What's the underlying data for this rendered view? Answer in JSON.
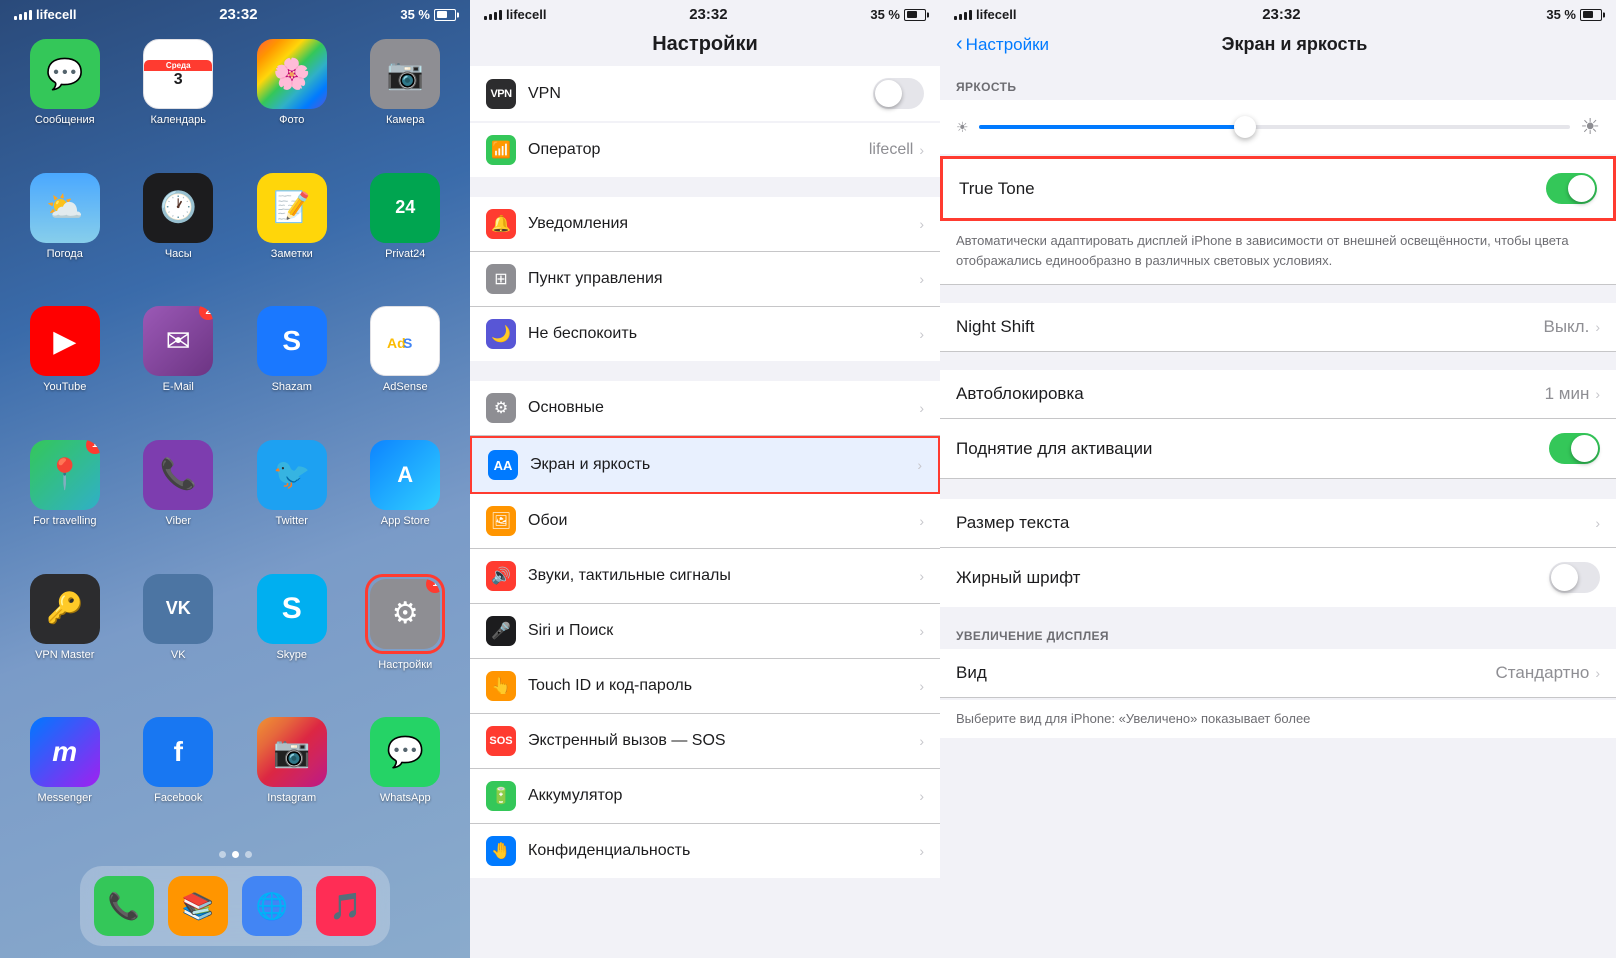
{
  "panel1": {
    "status": {
      "carrier": "lifecell",
      "time": "23:32",
      "battery": "35 %"
    },
    "apps": [
      {
        "id": "messages",
        "label": "Сообщения",
        "badge": null,
        "icon": "💬",
        "bg": "icon-messages"
      },
      {
        "id": "calendar",
        "label": "Календарь",
        "badge": null,
        "icon": "cal",
        "bg": "icon-calendar"
      },
      {
        "id": "photos",
        "label": "Фото",
        "badge": null,
        "icon": "🖼",
        "bg": "icon-photos"
      },
      {
        "id": "camera",
        "label": "Камера",
        "badge": null,
        "icon": "📷",
        "bg": "icon-camera"
      },
      {
        "id": "weather",
        "label": "Погода",
        "badge": null,
        "icon": "🌤",
        "bg": "icon-weather"
      },
      {
        "id": "clock",
        "label": "Часы",
        "badge": null,
        "icon": "⏰",
        "bg": "icon-clock"
      },
      {
        "id": "notes",
        "label": "Заметки",
        "badge": null,
        "icon": "📝",
        "bg": "icon-notes"
      },
      {
        "id": "privat24",
        "label": "Privat24",
        "badge": null,
        "icon": "24",
        "bg": "icon-privat"
      },
      {
        "id": "youtube",
        "label": "YouTube",
        "badge": null,
        "icon": "▶",
        "bg": "icon-youtube"
      },
      {
        "id": "email",
        "label": "E-Mail",
        "badge": "2",
        "icon": "✉",
        "bg": "icon-email"
      },
      {
        "id": "shazam",
        "label": "Shazam",
        "badge": null,
        "icon": "S",
        "bg": "icon-shazam"
      },
      {
        "id": "adsense",
        "label": "AdSense",
        "badge": null,
        "icon": "$",
        "bg": "icon-adsense"
      },
      {
        "id": "maps",
        "label": "For travelling",
        "badge": "1",
        "icon": "📍",
        "bg": "icon-maps"
      },
      {
        "id": "viber",
        "label": "Viber",
        "badge": null,
        "icon": "📞",
        "bg": "icon-viber"
      },
      {
        "id": "twitter",
        "label": "Twitter",
        "badge": null,
        "icon": "🐦",
        "bg": "icon-twitter"
      },
      {
        "id": "appstore",
        "label": "App Store",
        "badge": null,
        "icon": "A",
        "bg": "icon-appstore"
      },
      {
        "id": "vpn",
        "label": "VPN Master",
        "badge": null,
        "icon": "🔑",
        "bg": "icon-vpn"
      },
      {
        "id": "vk",
        "label": "VK",
        "badge": null,
        "icon": "VK",
        "bg": "icon-vk"
      },
      {
        "id": "skype",
        "label": "Skype",
        "badge": null,
        "icon": "S",
        "bg": "icon-skype"
      },
      {
        "id": "settings",
        "label": "Настройки",
        "badge": "1",
        "icon": "⚙",
        "bg": "icon-settings",
        "highlight": true
      },
      {
        "id": "messenger",
        "label": "Messenger",
        "badge": null,
        "icon": "m",
        "bg": "icon-messenger"
      },
      {
        "id": "facebook",
        "label": "Facebook",
        "badge": null,
        "icon": "f",
        "bg": "icon-facebook"
      },
      {
        "id": "instagram",
        "label": "Instagram",
        "badge": null,
        "icon": "📷",
        "bg": "icon-instagram"
      },
      {
        "id": "whatsapp",
        "label": "WhatsApp",
        "badge": null,
        "icon": "💬",
        "bg": "icon-whatsapp"
      }
    ],
    "dock": [
      {
        "id": "phone",
        "icon": "📞",
        "bg": "bg-green"
      },
      {
        "id": "ibooks",
        "icon": "📚",
        "bg": "bg-orange"
      },
      {
        "id": "chrome",
        "icon": "🌐",
        "bg": "bg-blue"
      },
      {
        "id": "music",
        "icon": "🎵",
        "bg": "bg-pink"
      }
    ]
  },
  "panel2": {
    "status": {
      "carrier": "lifecell",
      "time": "23:32",
      "battery": "35 %"
    },
    "title": "Настройки",
    "items": [
      {
        "id": "vpn",
        "label": "VPN",
        "value": "",
        "icon": "vpn",
        "iconColor": "#2c2c2e",
        "iconText": "VPN",
        "hasToggle": true,
        "toggleOn": false
      },
      {
        "id": "operator",
        "label": "Оператор",
        "value": "lifecell",
        "icon": "phone",
        "iconColor": "#34c759",
        "iconText": "📶",
        "hasChevron": true
      },
      {
        "id": "separator1",
        "type": "separator"
      },
      {
        "id": "notifications",
        "label": "Уведомления",
        "value": "",
        "icon": "notif",
        "iconColor": "#ff3b30",
        "iconText": "🔔",
        "hasChevron": true
      },
      {
        "id": "control",
        "label": "Пункт управления",
        "value": "",
        "icon": "ctrl",
        "iconColor": "#8e8e93",
        "iconText": "⊞",
        "hasChevron": true
      },
      {
        "id": "donotdisturb",
        "label": "Не беспокоить",
        "value": "",
        "icon": "dnd",
        "iconColor": "#5856d6",
        "iconText": "🌙",
        "hasChevron": true
      },
      {
        "id": "separator2",
        "type": "separator"
      },
      {
        "id": "general",
        "label": "Основные",
        "value": "",
        "icon": "gen",
        "iconColor": "#8e8e93",
        "iconText": "⚙",
        "hasChevron": true
      },
      {
        "id": "screenbrightness",
        "label": "Экран и яркость",
        "value": "",
        "icon": "screen",
        "iconColor": "#007aff",
        "iconText": "AA",
        "hasChevron": true,
        "highlighted": true
      },
      {
        "id": "wallpaper",
        "label": "Обои",
        "value": "",
        "icon": "wall",
        "iconColor": "#ff9500",
        "iconText": "🖼",
        "hasChevron": true
      },
      {
        "id": "sounds",
        "label": "Звуки, тактильные сигналы",
        "value": "",
        "icon": "sound",
        "iconColor": "#ff3b30",
        "iconText": "🔊",
        "hasChevron": true
      },
      {
        "id": "siri",
        "label": "Siri и Поиск",
        "value": "",
        "icon": "siri",
        "iconColor": "#000",
        "iconText": "🎤",
        "hasChevron": true
      },
      {
        "id": "touchid",
        "label": "Touch ID и код-пароль",
        "value": "",
        "icon": "touch",
        "iconColor": "#ff9500",
        "iconText": "👆",
        "hasChevron": true
      },
      {
        "id": "sos",
        "label": "Экстренный вызов — SOS",
        "value": "",
        "icon": "sos",
        "iconColor": "#ff3b30",
        "iconText": "SOS",
        "hasChevron": true
      },
      {
        "id": "battery",
        "label": "Аккумулятор",
        "value": "",
        "icon": "batt",
        "iconColor": "#34c759",
        "iconText": "🔋",
        "hasChevron": true
      },
      {
        "id": "privacy",
        "label": "Конфиденциальность",
        "value": "",
        "icon": "priv",
        "iconColor": "#007aff",
        "iconText": "🤚",
        "hasChevron": true
      }
    ]
  },
  "panel3": {
    "status": {
      "carrier": "lifecell",
      "time": "23:32",
      "battery": "35 %"
    },
    "backLabel": "Настройки",
    "title": "Экран и яркость",
    "brightnessSection": "ЯРКОСТЬ",
    "trueToneLabel": "True Tone",
    "trueToneOn": true,
    "trueToneDesc": "Автоматически адаптировать дисплей iPhone в зависимости от внешней освещённости, чтобы цвета отображались единообразно в различных световых условиях.",
    "nightShiftLabel": "Night Shift",
    "nightShiftValue": "Выкл.",
    "autolockLabel": "Автоблокировка",
    "autolockValue": "1 мин",
    "raiseLabel": "Поднятие для активации",
    "raiseOn": true,
    "textSizeLabel": "Размер текста",
    "boldLabel": "Жирный шрифт",
    "boldOn": false,
    "zoomSectionLabel": "УВЕЛИЧЕНИЕ ДИСПЛЕЯ",
    "viewLabel": "Вид",
    "viewValue": "Стандартно",
    "viewDescLabel": "Выберите вид для iPhone: «Увеличено» показывает более"
  }
}
